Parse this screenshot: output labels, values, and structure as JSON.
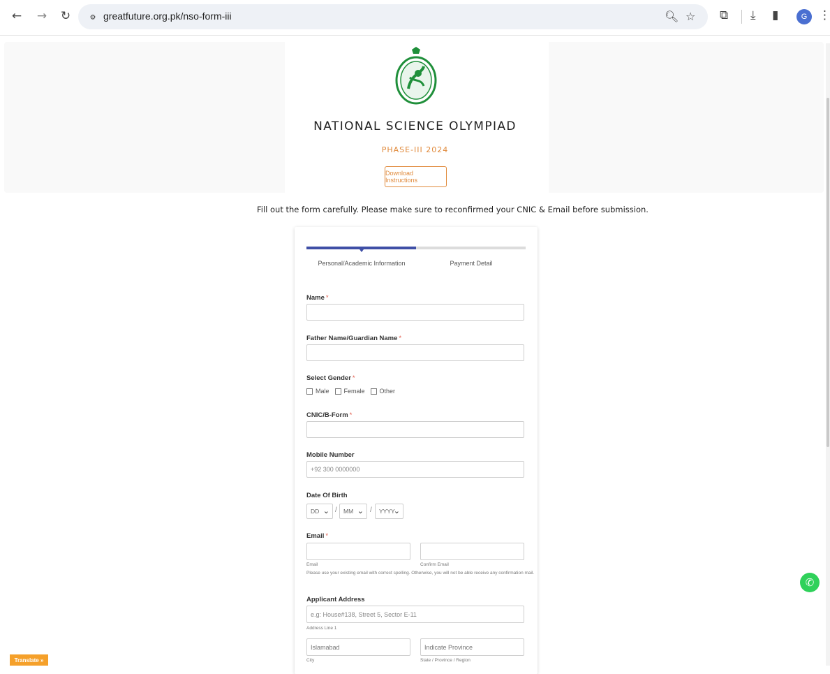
{
  "browser": {
    "url": "greatfuture.org.pk/nso-form-iii",
    "profile_initial": "G"
  },
  "page": {
    "title": "NATIONAL SCIENCE OLYMPIAD",
    "subtitle": "PHASE-III 2024",
    "download_button": "Download Instructions",
    "notice": "Fill out the form carefully. Please make sure to reconfirmed your CNIC & Email before submission."
  },
  "form": {
    "steps": [
      "Personal/Academic Information",
      "Payment Detail"
    ],
    "progress_fraction": 0.5,
    "name_label": "Name",
    "father_label": "Father Name/Guardian Name",
    "gender_label": "Select Gender",
    "gender_options": [
      "Male",
      "Female",
      "Other"
    ],
    "cnic_label": "CNIC/B-Form",
    "mobile_label": "Mobile Number",
    "mobile_placeholder": "+92 300 0000000",
    "dob_label": "Date Of Birth",
    "dob_day": "DD",
    "dob_month": "MM",
    "dob_year": "YYYY",
    "email_label": "Email",
    "email_sub": "Email",
    "confirm_email_sub": "Confirm Email",
    "email_hint": "Please use your existing email with correct spelling. Otherwise, you will not be able receive any confirmation mail.",
    "address_label": "Applicant Address",
    "address_placeholder": "e.g: House#138, Street 5, Sector E-11",
    "address_line_sub": "Address Line 1",
    "city_placeholder": "Islamabad",
    "city_sub": "City",
    "province_placeholder": "Indicate Province",
    "province_sub": "State / Province / Region",
    "required_mark": "*"
  },
  "widgets": {
    "translate_label": "Translate »"
  },
  "colors": {
    "accent_orange": "#e08a3c",
    "progress_blue": "#3f4fa6",
    "logo_green": "#1f8f3a",
    "whatsapp_green": "#2fd15a"
  }
}
